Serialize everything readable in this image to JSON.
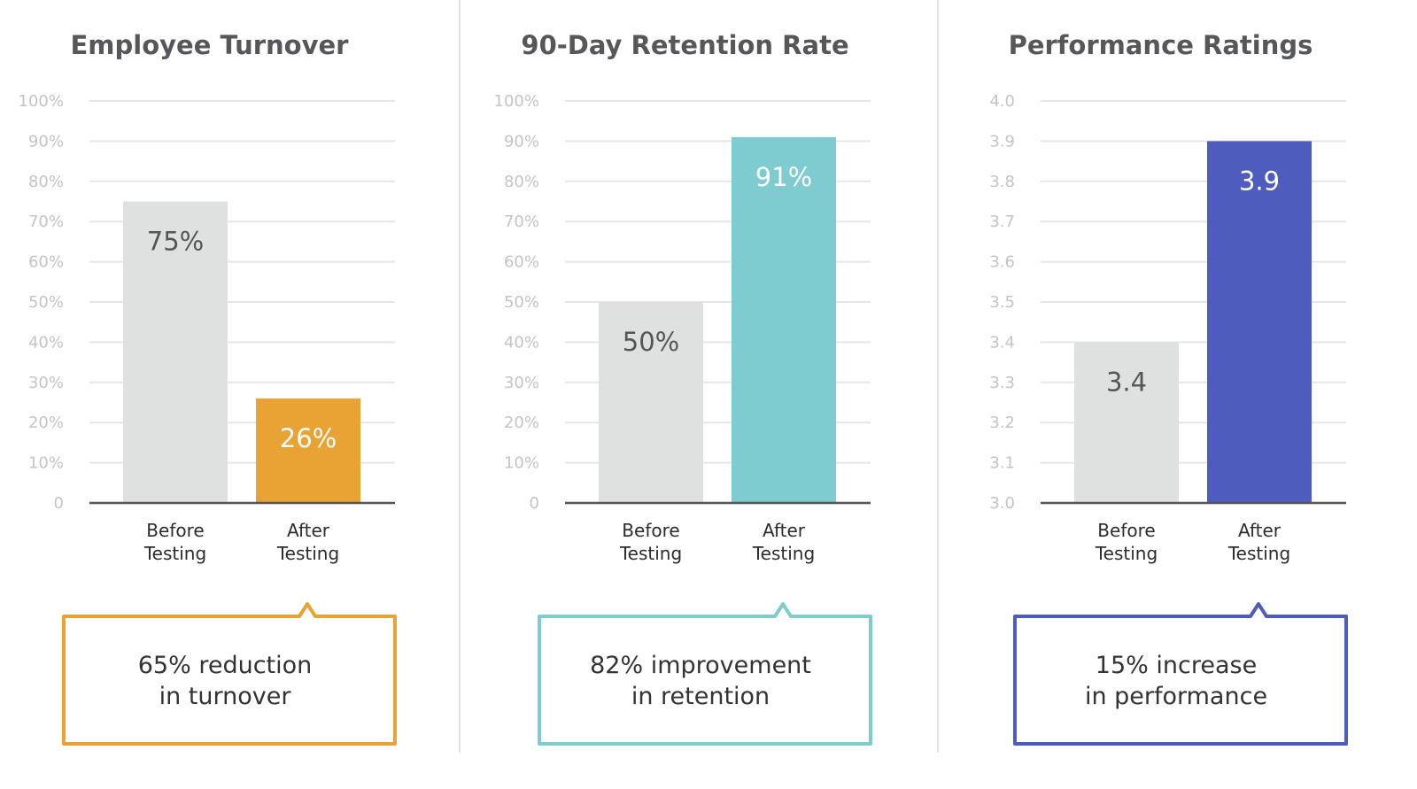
{
  "chart_data": [
    {
      "type": "bar",
      "title": "Employee Turnover",
      "categories": [
        [
          "Before",
          "Testing"
        ],
        [
          "After",
          "Testing"
        ]
      ],
      "values": [
        75,
        26
      ],
      "value_labels": [
        "75%",
        "26%"
      ],
      "colors": [
        "#dfe0e0",
        "#e8a334"
      ],
      "label_colors": [
        "#555555",
        "#ffffff"
      ],
      "ylim": [
        0,
        100
      ],
      "yticks": [
        0,
        10,
        20,
        30,
        40,
        50,
        60,
        70,
        80,
        90,
        100
      ],
      "ytick_labels": [
        "0",
        "10%",
        "20%",
        "30%",
        "40%",
        "50%",
        "60%",
        "70%",
        "80%",
        "90%",
        "100%"
      ],
      "grid": true,
      "xlabel": "",
      "ylabel": "",
      "callout": {
        "lines": [
          "65% reduction",
          "in turnover"
        ],
        "color": "#e8a334"
      }
    },
    {
      "type": "bar",
      "title": "90-Day Retention Rate",
      "categories": [
        [
          "Before",
          "Testing"
        ],
        [
          "After",
          "Testing"
        ]
      ],
      "values": [
        50,
        91
      ],
      "value_labels": [
        "50%",
        "91%"
      ],
      "colors": [
        "#dfe0e0",
        "#7ecbd0"
      ],
      "label_colors": [
        "#555555",
        "#ffffff"
      ],
      "ylim": [
        0,
        100
      ],
      "yticks": [
        0,
        10,
        20,
        30,
        40,
        50,
        60,
        70,
        80,
        90,
        100
      ],
      "ytick_labels": [
        "0",
        "10%",
        "20%",
        "30%",
        "40%",
        "50%",
        "60%",
        "70%",
        "80%",
        "90%",
        "100%"
      ],
      "grid": true,
      "xlabel": "",
      "ylabel": "",
      "callout": {
        "lines": [
          "82% improvement",
          "in retention"
        ],
        "color": "#7ecbd0"
      }
    },
    {
      "type": "bar",
      "title": "Performance Ratings",
      "categories": [
        [
          "Before",
          "Testing"
        ],
        [
          "After",
          "Testing"
        ]
      ],
      "values": [
        3.4,
        3.9
      ],
      "value_labels": [
        "3.4",
        "3.9"
      ],
      "colors": [
        "#dfe0e0",
        "#4e5cbe"
      ],
      "label_colors": [
        "#555555",
        "#ffffff"
      ],
      "ylim": [
        3.0,
        4.0
      ],
      "yticks": [
        3.0,
        3.1,
        3.2,
        3.3,
        3.4,
        3.5,
        3.6,
        3.7,
        3.8,
        3.9,
        4.0
      ],
      "ytick_labels": [
        "3.0",
        "3.1",
        "3.2",
        "3.3",
        "3.4",
        "3.5",
        "3.6",
        "3.7",
        "3.8",
        "3.9",
        "4.0"
      ],
      "grid": true,
      "xlabel": "",
      "ylabel": "",
      "callout": {
        "lines": [
          "15% increase",
          "in performance"
        ],
        "color": "#4e5cbe"
      }
    }
  ]
}
